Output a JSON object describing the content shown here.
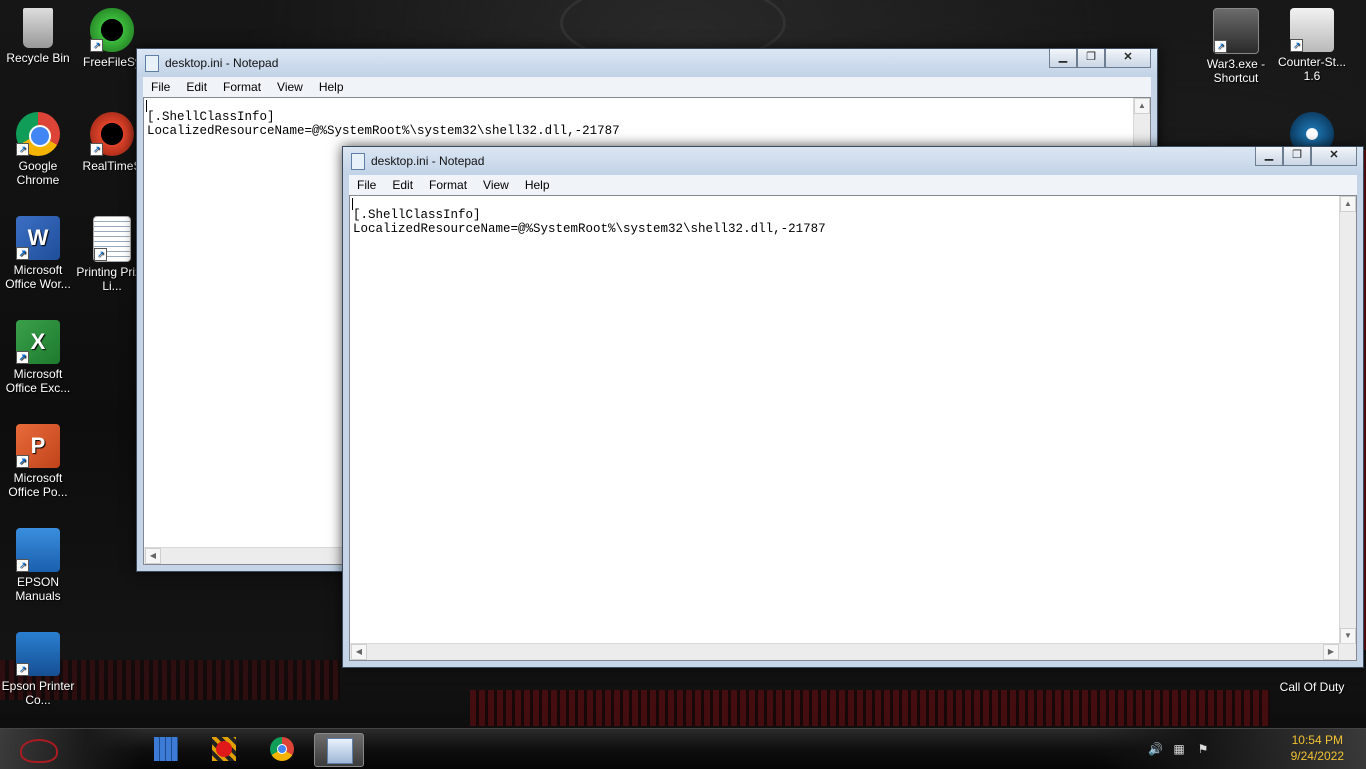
{
  "desktop": {
    "icons_left": [
      {
        "label": "Recycle Bin",
        "icon": "recycle-bin-icon"
      },
      {
        "label": "FreeFileSy",
        "icon": "freefilesync-icon"
      },
      {
        "label": "Google Chrome",
        "icon": "chrome-icon"
      },
      {
        "label": "RealTimeS",
        "icon": "realtimesync-icon"
      },
      {
        "label": "Microsoft Office Wor...",
        "icon": "word-icon"
      },
      {
        "label": "Printing Prize Li...",
        "icon": "word-document-icon"
      },
      {
        "label": "Microsoft Office Exc...",
        "icon": "excel-icon"
      },
      {
        "label": "Microsoft Office Po...",
        "icon": "powerpoint-icon"
      },
      {
        "label": "EPSON Manuals",
        "icon": "epson-manuals-icon"
      },
      {
        "label": "Epson Printer Co...",
        "icon": "epson-printer-icon"
      }
    ],
    "icons_right": [
      {
        "label": "War3.exe - Shortcut",
        "icon": "warcraft3-icon"
      },
      {
        "label": "Counter-St... 1.6",
        "icon": "counter-strike-icon"
      },
      {
        "label": "Call Of Duty",
        "icon": "call-of-duty-icon"
      }
    ]
  },
  "window_back": {
    "title": "desktop.ini - Notepad",
    "menu": [
      "File",
      "Edit",
      "Format",
      "View",
      "Help"
    ],
    "content": "[.ShellClassInfo]\nLocalizedResourceName=@%SystemRoot%\\system32\\shell32.dll,-21787",
    "controls": {
      "minimize": "▁",
      "restore": "❐",
      "close": "✕"
    }
  },
  "window_front": {
    "title": "desktop.ini - Notepad",
    "menu": [
      "File",
      "Edit",
      "Format",
      "View",
      "Help"
    ],
    "content": "[.ShellClassInfo]\nLocalizedResourceName=@%SystemRoot%\\system32\\shell32.dll,-21787",
    "controls": {
      "minimize": "▁",
      "restore": "❐",
      "close": "✕"
    }
  },
  "taskbar": {
    "apps": [
      {
        "name": "explorer",
        "icon": "file-explorer-icon"
      },
      {
        "name": "recorder",
        "icon": "record-icon"
      },
      {
        "name": "chrome",
        "icon": "chrome-icon"
      },
      {
        "name": "notepad",
        "icon": "notepad-icon",
        "active": true
      }
    ],
    "clock_time": "10:54 PM",
    "clock_date": "9/24/2022",
    "tray": [
      "volume-icon",
      "network-icon",
      "action-center-icon"
    ]
  }
}
